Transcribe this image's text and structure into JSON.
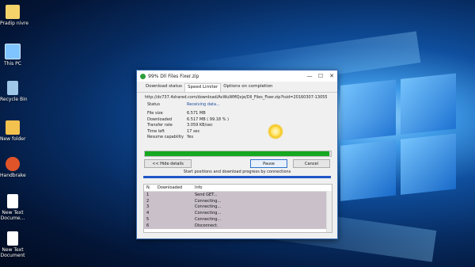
{
  "desktop": {
    "icons": [
      {
        "label": "Pradip nivre",
        "icon": "user-folder-icon",
        "color": "#f5d36b"
      },
      {
        "label": "This PC",
        "icon": "computer-icon",
        "color": "#7fc4ff"
      },
      {
        "label": "Recycle Bin",
        "icon": "recycle-bin-icon",
        "color": "#9fc8e8"
      },
      {
        "label": "New folder",
        "icon": "folder-icon",
        "color": "#f2c14e"
      },
      {
        "label": "Handbrake",
        "icon": "handbrake-icon",
        "color": "#e0542a"
      },
      {
        "label": "New Text\nDocume...",
        "icon": "text-document-icon",
        "color": "#ffffff"
      },
      {
        "label": "New Text\nDocument",
        "icon": "text-document-icon",
        "color": "#ffffff"
      }
    ]
  },
  "dialog": {
    "title": "99% Dll Files Fixer.zip",
    "tabs": [
      "Download status",
      "Speed Limiter",
      "Options on completion"
    ],
    "url": "http://dc737.4shared.com/download/AvWuWMQxje/Dll_Files_Fixer.zip?tsid=20160307-130556406",
    "status_label": "Status",
    "status_value": "Receiving data...",
    "info_rows": [
      {
        "label": "File size",
        "value": "6.571  MB"
      },
      {
        "label": "Downloaded",
        "value": "6.517  MB  ( 99.18 % )"
      },
      {
        "label": "Transfer rate",
        "value": "3.059  KB/sec"
      },
      {
        "label": "Time left",
        "value": "17 sec"
      },
      {
        "label": "Resume capability",
        "value": "Yes"
      }
    ],
    "progress_fraction": 0.9918,
    "buttons": {
      "hide_details": "<< Hide details",
      "pause": "Pause",
      "cancel": "Cancel"
    },
    "caption": "Start positions and download progress by connections",
    "table": {
      "headers": [
        "N.",
        "Downloaded",
        "Info"
      ],
      "rows": [
        {
          "n": "1",
          "downloaded": "",
          "info": "Send GET..."
        },
        {
          "n": "2",
          "downloaded": "",
          "info": "Connecting..."
        },
        {
          "n": "3",
          "downloaded": "",
          "info": "Connecting..."
        },
        {
          "n": "4",
          "downloaded": "",
          "info": "Connecting..."
        },
        {
          "n": "5",
          "downloaded": "",
          "info": "Connecting..."
        },
        {
          "n": "6",
          "downloaded": "",
          "info": "Disconnect."
        }
      ]
    }
  },
  "colors": {
    "progress": "#15a820",
    "accent": "#1f56c7",
    "status_text": "#1a4a9a"
  }
}
